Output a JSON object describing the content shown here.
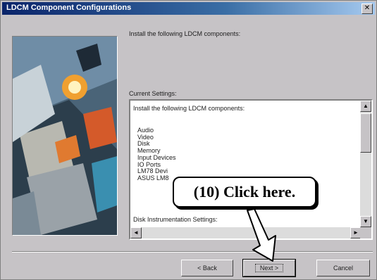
{
  "window": {
    "title": "LDCM Component Configurations"
  },
  "intro": {
    "text": "Install the following LDCM components:"
  },
  "current": {
    "label": "Current Settings:",
    "heading": "Install the following LDCM components:",
    "components": [
      "Audio",
      "Video",
      "Disk",
      "Memory",
      "Input Devices",
      "IO Ports",
      "LM78 Devi",
      "ASUS LM8"
    ],
    "disk_label": "Disk Instrumentation Settings:"
  },
  "buttons": {
    "back": "< Back",
    "next": "Next >",
    "cancel": "Cancel"
  },
  "callout": {
    "text": "(10)  Click here."
  },
  "icons": [
    "close-icon",
    "scroll-up-icon",
    "scroll-down-icon",
    "scroll-left-icon",
    "scroll-right-icon",
    "size-grip-icon",
    "pointer-arrow-icon"
  ],
  "colors": {
    "titlebar_start": "#0a246a",
    "titlebar_end": "#a6caf0",
    "dialog_face": "#c6c3c6"
  }
}
